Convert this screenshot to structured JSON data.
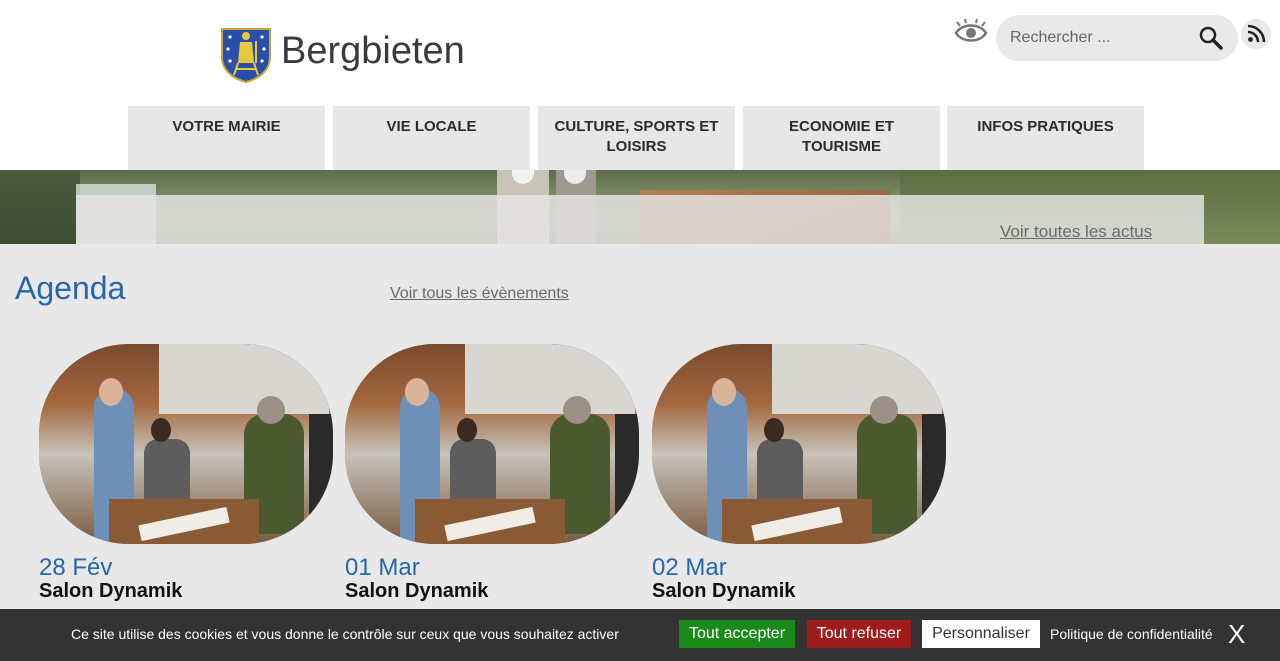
{
  "header": {
    "site_title": "Bergbieten",
    "search_placeholder": "Rechercher ...",
    "icons": [
      "coat-of-arms-logo",
      "eye-icon",
      "search-icon",
      "rss-icon"
    ]
  },
  "nav": [
    {
      "label": "VOTRE MAIRIE"
    },
    {
      "label": "VIE LOCALE"
    },
    {
      "label": "CULTURE, SPORTS ET LOISIRS"
    },
    {
      "label": "ECONOMIE ET TOURISME"
    },
    {
      "label": "INFOS PRATIQUES"
    }
  ],
  "banner": {
    "link_label": "Voir toutes les actus"
  },
  "agenda": {
    "title": "Agenda",
    "link_label": "Voir tous les évènements",
    "events": [
      {
        "date": "28 Fév",
        "title": "Salon Dynamik"
      },
      {
        "date": "01 Mar",
        "title": "Salon Dynamik"
      },
      {
        "date": "02 Mar",
        "title": "Salon Dynamik"
      }
    ]
  },
  "cookie_bar": {
    "text": "Ce site utilise des cookies et vous donne le contrôle sur ceux que vous souhaitez activer",
    "accept_label": "Tout accepter",
    "refuse_label": "Tout refuser",
    "customize_label": "Personnaliser",
    "policy_label": "Politique de confidentialité",
    "close_label": "X"
  },
  "colors": {
    "accent_blue": "#2766a8",
    "accept_green": "#1a8a1a",
    "refuse_red": "#9e1c1c",
    "cookie_bg": "#333333"
  }
}
